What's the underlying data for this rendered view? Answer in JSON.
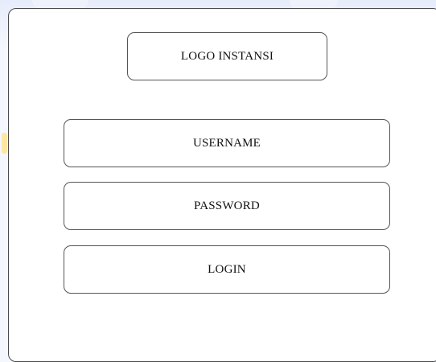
{
  "login_form": {
    "logo_label": "LOGO INSTANSI",
    "username_label": "USERNAME",
    "password_label": "PASSWORD",
    "login_button_label": "LOGIN"
  }
}
